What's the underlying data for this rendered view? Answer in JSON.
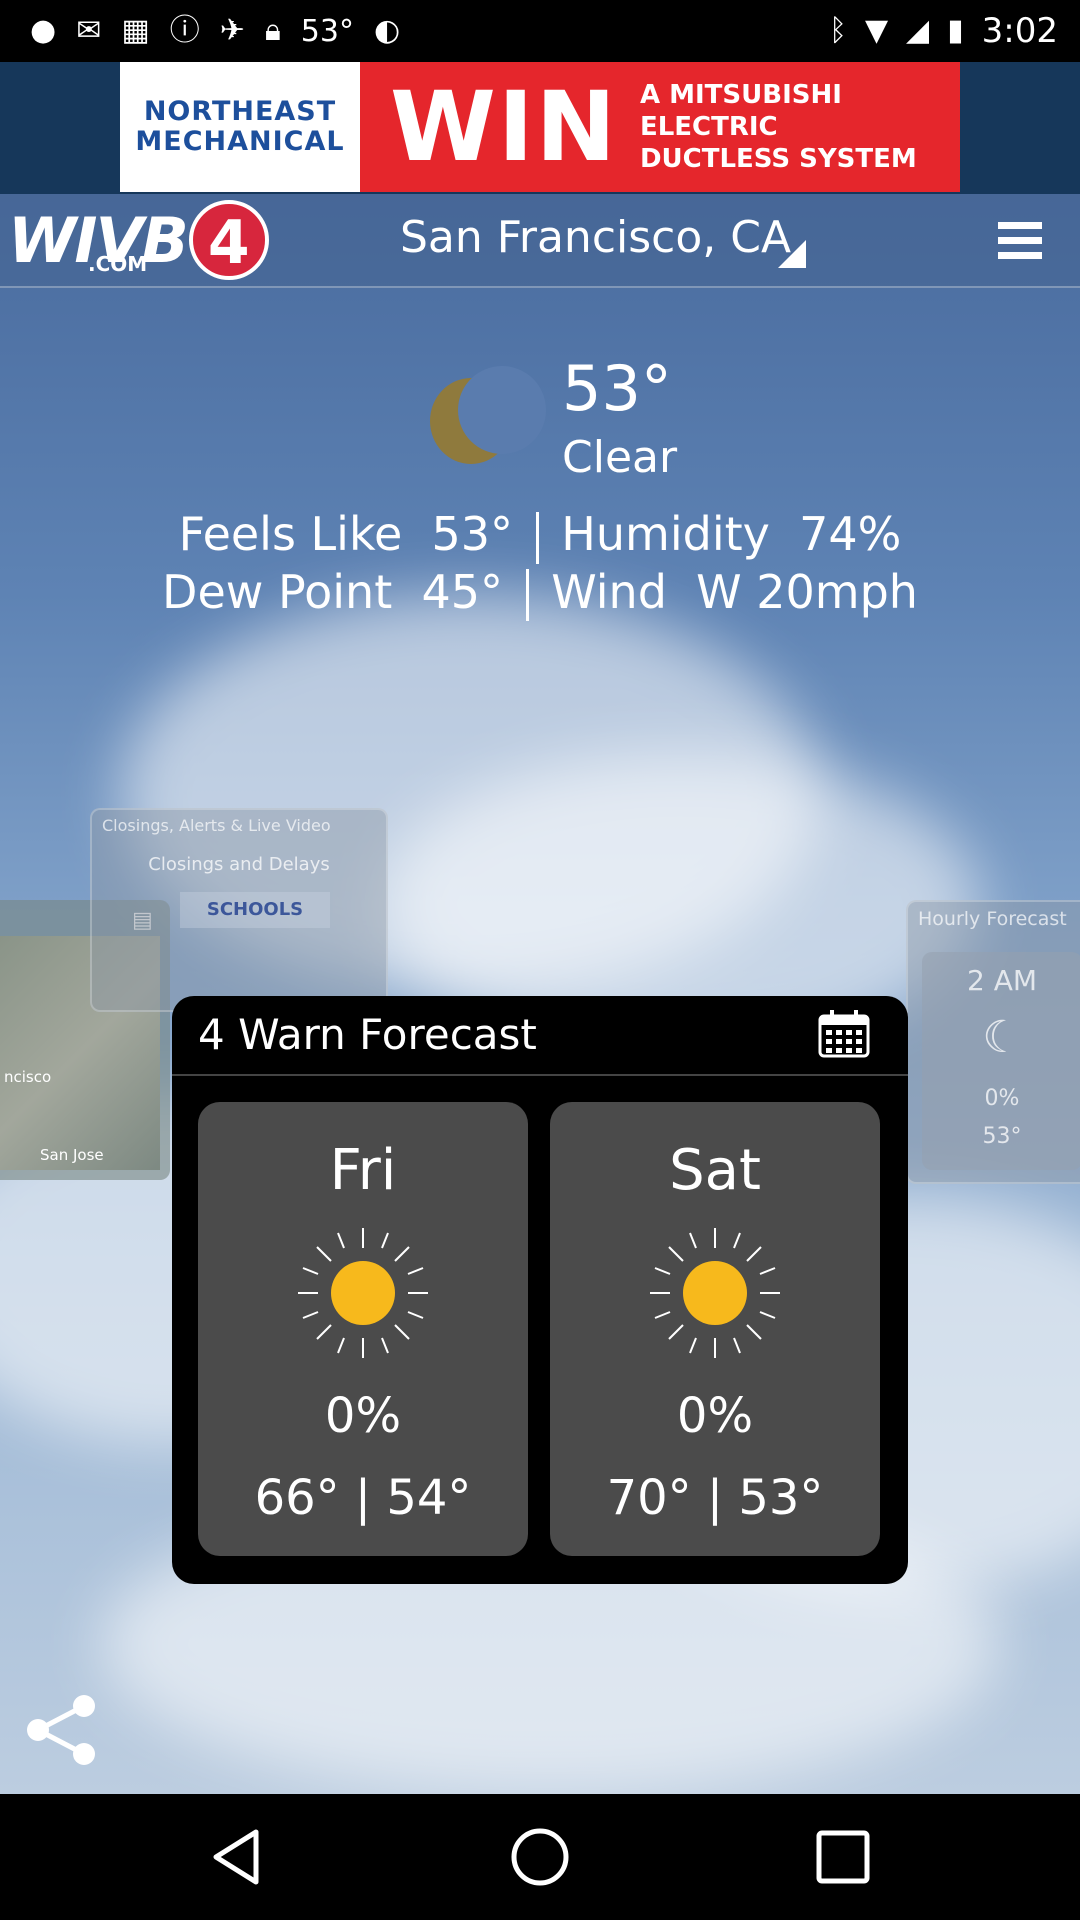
{
  "status_bar": {
    "temperature": "53°",
    "time": "3:02"
  },
  "ad": {
    "brand_line1": "NORTHEAST",
    "brand_line2": "MECHANICAL",
    "headline": "WIN",
    "tagline_line1": "A MITSUBISHI ELECTRIC",
    "tagline_line2": "DUCTLESS SYSTEM"
  },
  "header": {
    "logo_text": "WIVB",
    "logo_sub": ".COM",
    "logo_number": "4",
    "location": "San Francisco, CA"
  },
  "current": {
    "temperature": "53°",
    "condition": "Clear",
    "feels_like_label": "Feels Like",
    "feels_like_value": "53°",
    "humidity_label": "Humidity",
    "humidity_value": "74%",
    "dew_point_label": "Dew Point",
    "dew_point_value": "45°",
    "wind_label": "Wind",
    "wind_value": "W 20mph"
  },
  "background_cards": {
    "map": {
      "label_city1": "ncisco",
      "label_city2": "San Jose"
    },
    "closings": {
      "title": "Closings, Alerts & Live Video",
      "subtitle": "Closings and Delays",
      "image_text": "SCHOOLS"
    },
    "hourly": {
      "title": "Hourly Forecast",
      "time": "2 AM",
      "precip": "0%",
      "temp": "53°"
    }
  },
  "forecast": {
    "title": "4 Warn Forecast",
    "days": [
      {
        "name": "Fri",
        "icon": "sun-icon",
        "precip": "0%",
        "temps": "66° | 54°"
      },
      {
        "name": "Sat",
        "icon": "sun-icon",
        "precip": "0%",
        "temps": "70° | 53°"
      }
    ]
  },
  "colors": {
    "sun": "#f7b91c",
    "moon": "#8f7a3d",
    "ad_red": "#e5262c",
    "card_bg": "#4b4b4b"
  }
}
